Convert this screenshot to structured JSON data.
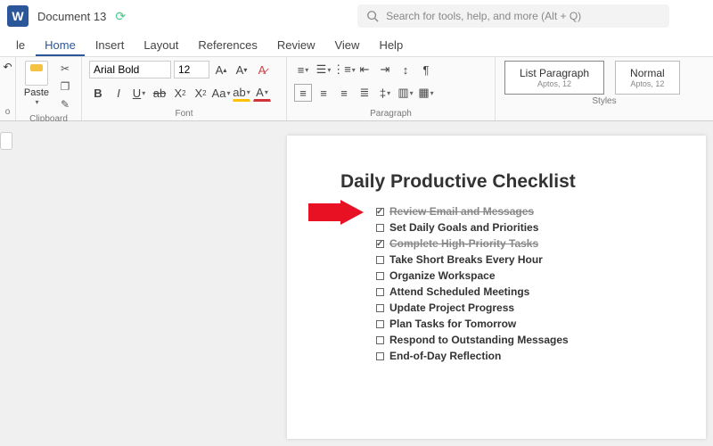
{
  "title": "Document 13",
  "search": {
    "placeholder": "Search for tools, help, and more (Alt + Q)"
  },
  "menu": [
    "le",
    "Home",
    "Insert",
    "Layout",
    "References",
    "Review",
    "View",
    "Help"
  ],
  "menu_active": 1,
  "clipboard": {
    "paste": "Paste",
    "label": "Clipboard"
  },
  "font": {
    "name": "Arial Bold",
    "size": "12",
    "label": "Font"
  },
  "paragraph": {
    "label": "Paragraph"
  },
  "styles": {
    "label": "Styles",
    "cards": [
      {
        "name": "List Paragraph",
        "sub": "Aptos, 12"
      },
      {
        "name": "Normal",
        "sub": "Aptos, 12"
      }
    ]
  },
  "document": {
    "heading": "Daily Productive Checklist",
    "items": [
      {
        "text": "Review Email and Messages",
        "checked": true,
        "strike": true
      },
      {
        "text": "Set Daily Goals and Priorities",
        "checked": false,
        "strike": false
      },
      {
        "text": "Complete High-Priority Tasks",
        "checked": true,
        "strike": true
      },
      {
        "text": "Take Short Breaks Every Hour",
        "checked": false,
        "strike": false
      },
      {
        "text": "Organize Workspace",
        "checked": false,
        "strike": false
      },
      {
        "text": " Attend Scheduled Meetings",
        "checked": false,
        "strike": false
      },
      {
        "text": "Update Project Progress",
        "checked": false,
        "strike": false
      },
      {
        "text": " Plan Tasks for Tomorrow",
        "checked": false,
        "strike": false
      },
      {
        "text": "Respond to Outstanding Messages",
        "checked": false,
        "strike": false
      },
      {
        "text": "End-of-Day Reflection",
        "checked": false,
        "strike": false
      }
    ]
  }
}
